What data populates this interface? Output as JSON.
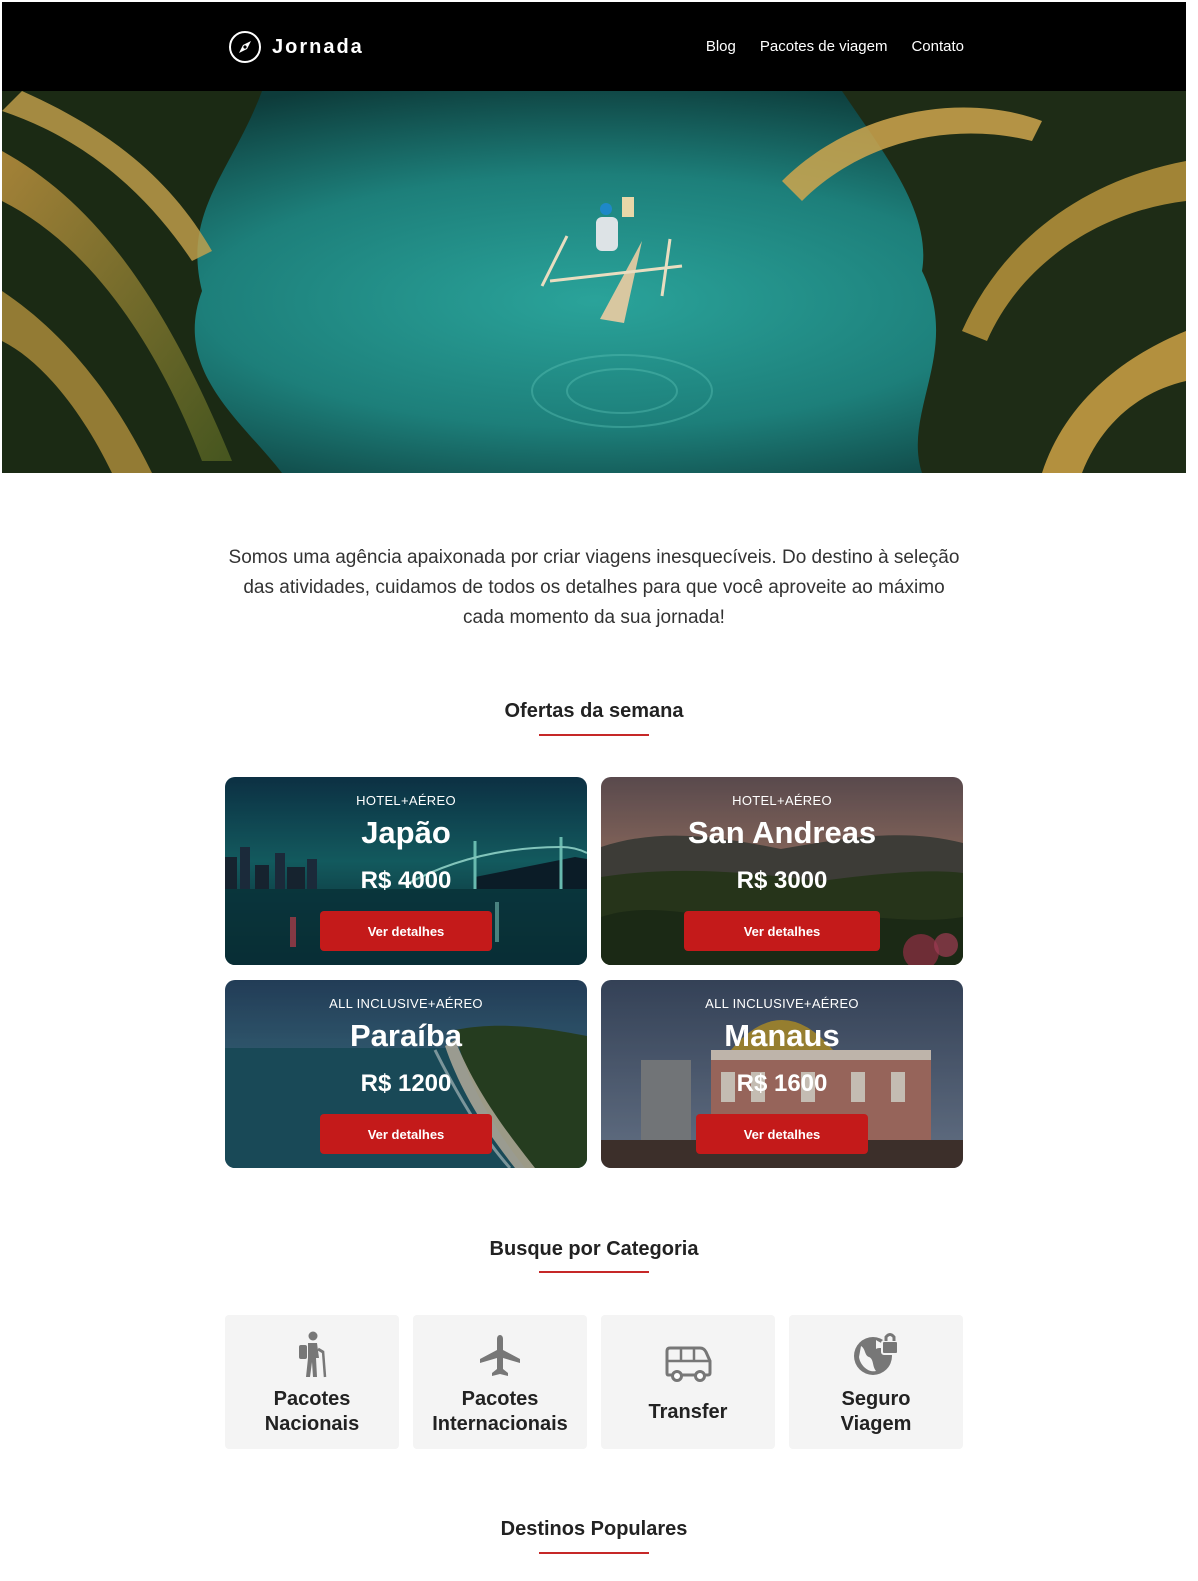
{
  "header": {
    "logo_text": "Jornada",
    "nav": [
      "Blog",
      "Pacotes de viagem",
      "Contato"
    ]
  },
  "intro": "Somos uma agência apaixonada por criar viagens inesquecíveis. Do destino à seleção das atividades, cuidamos de todos os detalhes para que você aproveite ao máximo cada momento da sua jornada!",
  "offers": {
    "title": "Ofertas da semana",
    "cards": [
      {
        "tag": "HOTEL+AÉREO",
        "destination": "Japão",
        "price": "R$ 4000",
        "button": "Ver detalhes"
      },
      {
        "tag": "HOTEL+AÉREO",
        "destination": "San Andreas",
        "price": "R$ 3000",
        "button": "Ver detalhes"
      },
      {
        "tag": "ALL INCLUSIVE+AÉREO",
        "destination": "Paraíba",
        "price": "R$ 1200",
        "button": "Ver detalhes"
      },
      {
        "tag": "ALL INCLUSIVE+AÉREO",
        "destination": "Manaus",
        "price": "R$ 1600",
        "button": "Ver detalhes"
      }
    ]
  },
  "categories": {
    "title": "Busque por Categoria",
    "items": [
      {
        "line1": "Pacotes",
        "line2": "Nacionais",
        "icon": "hiker-icon"
      },
      {
        "line1": "Pacotes",
        "line2": "Internacionais",
        "icon": "airplane-icon"
      },
      {
        "line1": "Transfer",
        "line2": "",
        "icon": "van-icon"
      },
      {
        "line1": "Seguro",
        "line2": "Viagem",
        "icon": "globe-lock-icon"
      }
    ]
  },
  "popular": {
    "title": "Destinos Populares"
  },
  "colors": {
    "accent": "#c41a1a",
    "header_bg": "#000000",
    "tile_bg": "#f4f4f4"
  }
}
